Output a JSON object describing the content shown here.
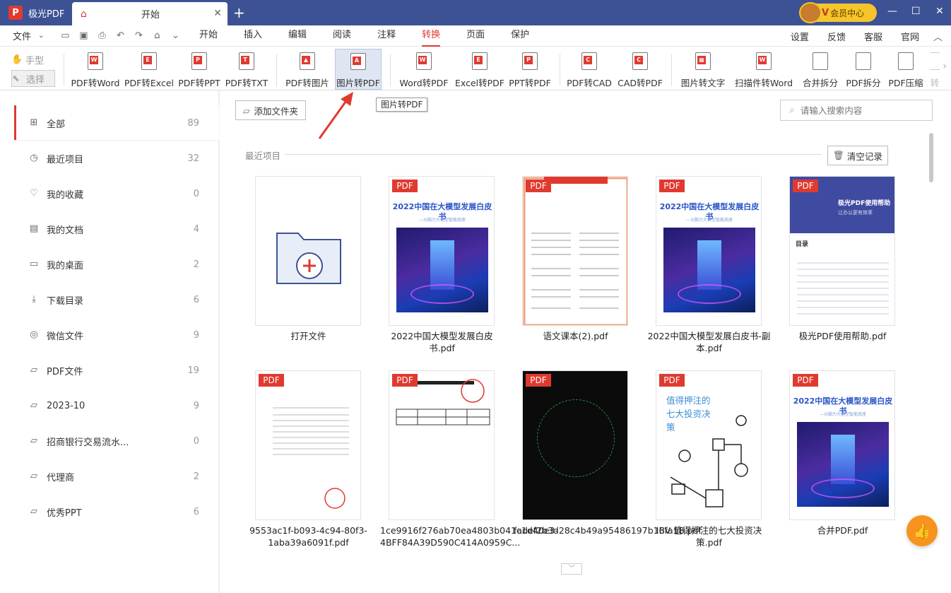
{
  "app": {
    "name": "极光PDF",
    "logo_letter": "P"
  },
  "tab": {
    "title": "开始"
  },
  "vip": {
    "badge": "V",
    "label": "会员中心"
  },
  "menu": {
    "file": "文件",
    "tabs": [
      "开始",
      "插入",
      "编辑",
      "阅读",
      "注释",
      "转换",
      "页面",
      "保护"
    ],
    "active_tab": "转换",
    "right": [
      "设置",
      "反馈",
      "客服",
      "官网"
    ]
  },
  "ribbon": {
    "hand": "手型",
    "select": "选择",
    "tools": [
      "PDF转Word",
      "PDF转Excel",
      "PDF转PPT",
      "PDF转TXT",
      "PDF转图片",
      "图片转PDF",
      "Word转PDF",
      "Excel转PDF",
      "PPT转PDF",
      "PDF转CAD",
      "CAD转PDF",
      "图片转文字",
      "扫描件转Word",
      "合并拆分",
      "PDF拆分",
      "PDF压缩",
      "转"
    ],
    "tooltip": "图片转PDF"
  },
  "sidebar": [
    {
      "label": "全部",
      "count": "89",
      "icon": "grid-icon"
    },
    {
      "label": "最近项目",
      "count": "32",
      "icon": "clock-icon"
    },
    {
      "label": "我的收藏",
      "count": "0",
      "icon": "heart-icon"
    },
    {
      "label": "我的文档",
      "count": "4",
      "icon": "document-icon"
    },
    {
      "label": "我的桌面",
      "count": "2",
      "icon": "monitor-icon"
    },
    {
      "label": "下载目录",
      "count": "6",
      "icon": "download-icon"
    },
    {
      "label": "微信文件",
      "count": "9",
      "icon": "wechat-icon"
    },
    {
      "label": "PDF文件",
      "count": "19",
      "icon": "folder-icon"
    },
    {
      "label": "2023-10",
      "count": "9",
      "icon": "folder-icon"
    },
    {
      "label": "招商银行交易流水...",
      "count": "0",
      "icon": "folder-icon"
    },
    {
      "label": "代理商",
      "count": "2",
      "icon": "folder-icon"
    },
    {
      "label": "优秀PPT",
      "count": "6",
      "icon": "folder-icon"
    }
  ],
  "main": {
    "add_folder": "添加文件夹",
    "search_placeholder": "请输入搜索内容",
    "recent_label": "最近项目",
    "clear": "清空记录",
    "pdf_badge": "PDF",
    "open_file": "打开文件",
    "whitepaper_title": "2022中国在大模型发展白皮书",
    "whitepaper_sub": "—元脑力大模型智能底座",
    "files": [
      "2022中国大模型发展白皮书.pdf",
      "语文课本(2).pdf",
      "2022中国大模型发展白皮书-副本.pdf",
      "极光PDF使用帮助.pdf",
      "9553ac1f-b093-4c94-80f3-1aba39a6091f.pdf",
      "1ce9916f276ab70ea4803b041c1d40e3-4BFF84A39D590C414A0959C...",
      "fadef2b3d28c4b49a95486197b16fa18.pdf",
      "IBV 值得押注的七大投资决策.pdf",
      "合并PDF.pdf"
    ],
    "help_title": "极光PDF使用帮助",
    "help_sub": "让办公更有效率",
    "help_toc": "目录",
    "ibv_title": "值得押注的七大投资决策"
  },
  "colors": {
    "accent": "#e03a30",
    "titlebar": "#3d5294",
    "vip": "#f5c52b",
    "like": "#f7931e"
  }
}
